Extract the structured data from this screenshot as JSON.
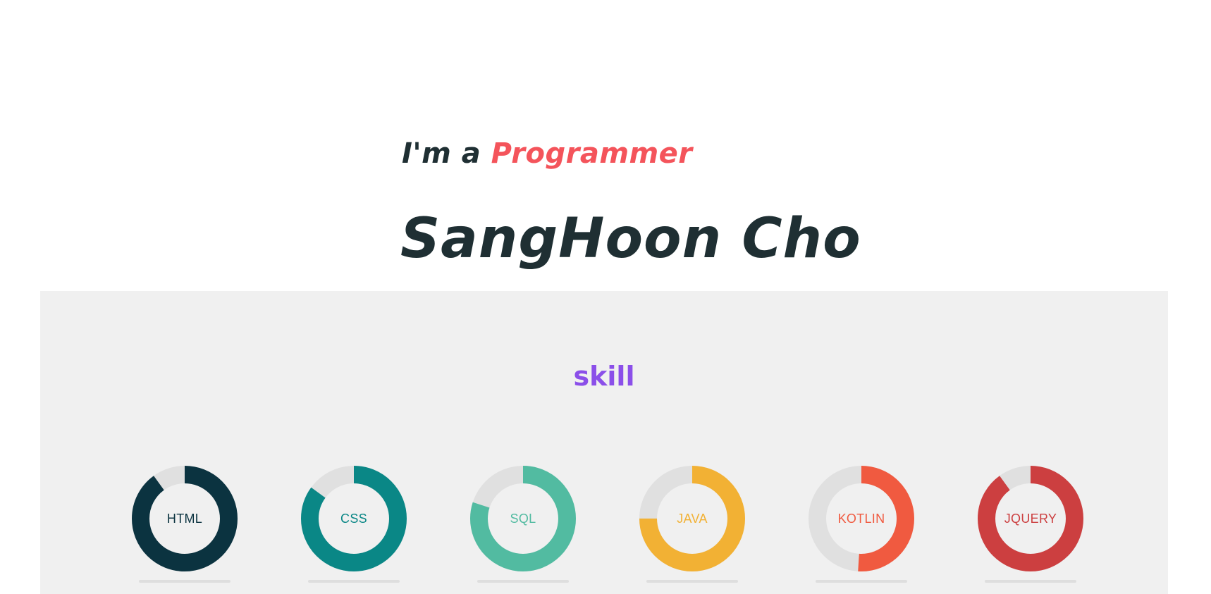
{
  "hero": {
    "tagline_prefix": "I'm a",
    "tagline_role": "Programmer",
    "name": "SangHoon Cho"
  },
  "colors": {
    "text_dark": "#1f2f33",
    "role_accent": "#f4545b",
    "skill_title": "#8b4fe9",
    "section_bg": "#f0f0f0",
    "track": "#e0e0e0"
  },
  "skills": {
    "title": "skill",
    "items": [
      {
        "label": "HTML",
        "percent": 90,
        "color": "#0b3340"
      },
      {
        "label": "CSS",
        "percent": 85,
        "color": "#0a8786"
      },
      {
        "label": "SQL",
        "percent": 80,
        "color": "#52bba1"
      },
      {
        "label": "JAVA",
        "percent": 75,
        "color": "#f2b134"
      },
      {
        "label": "KOTLIN",
        "percent": 51,
        "color": "#f05a40"
      },
      {
        "label": "JQUERY",
        "percent": 90,
        "color": "#cc3f40"
      }
    ]
  }
}
